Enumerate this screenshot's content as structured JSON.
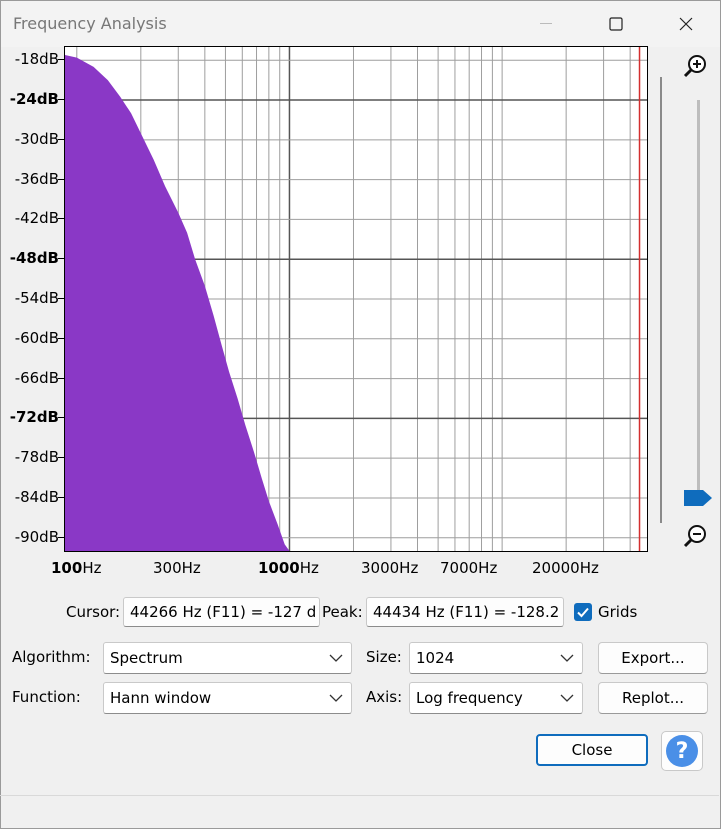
{
  "window": {
    "title": "Frequency Analysis"
  },
  "chart_data": {
    "type": "area",
    "title": "",
    "xlabel": "",
    "ylabel": "",
    "x_scale": "log",
    "xlim": [
      88,
      48000
    ],
    "ylim": [
      -92,
      -16
    ],
    "grid": true,
    "y_ticks": [
      {
        "label": "-18dB",
        "value": -18,
        "bold": false
      },
      {
        "label": "-24dB",
        "value": -24,
        "bold": true
      },
      {
        "label": "-30dB",
        "value": -30,
        "bold": false
      },
      {
        "label": "-36dB",
        "value": -36,
        "bold": false
      },
      {
        "label": "-42dB",
        "value": -42,
        "bold": false
      },
      {
        "label": "-48dB",
        "value": -48,
        "bold": true
      },
      {
        "label": "-54dB",
        "value": -54,
        "bold": false
      },
      {
        "label": "-60dB",
        "value": -60,
        "bold": false
      },
      {
        "label": "-66dB",
        "value": -66,
        "bold": false
      },
      {
        "label": "-72dB",
        "value": -72,
        "bold": true
      },
      {
        "label": "-78dB",
        "value": -78,
        "bold": false
      },
      {
        "label": "-84dB",
        "value": -84,
        "bold": false
      },
      {
        "label": "-90dB",
        "value": -90,
        "bold": false
      }
    ],
    "x_ticks": [
      {
        "label": "100Hz",
        "value": 100,
        "boldpart": "100",
        "rest": "Hz"
      },
      {
        "label": "300Hz",
        "value": 300,
        "boldpart": "",
        "rest": "300Hz"
      },
      {
        "label": "1000Hz",
        "value": 1000,
        "boldpart": "1000",
        "rest": "Hz"
      },
      {
        "label": "3000Hz",
        "value": 3000,
        "boldpart": "",
        "rest": "3000Hz"
      },
      {
        "label": "7000Hz",
        "value": 7000,
        "boldpart": "",
        "rest": "7000Hz"
      },
      {
        "label": "20000Hz",
        "value": 20000,
        "boldpart": "",
        "rest": "20000Hz"
      }
    ],
    "series": [
      {
        "color": "#8a38c6",
        "points": [
          [
            88,
            -17.2
          ],
          [
            100,
            -17.6
          ],
          [
            120,
            -19
          ],
          [
            140,
            -21
          ],
          [
            160,
            -23.5
          ],
          [
            180,
            -26
          ],
          [
            200,
            -29
          ],
          [
            230,
            -33
          ],
          [
            260,
            -37
          ],
          [
            300,
            -41
          ],
          [
            330,
            -44
          ],
          [
            360,
            -48
          ],
          [
            400,
            -52
          ],
          [
            440,
            -56.5
          ],
          [
            480,
            -61
          ],
          [
            520,
            -65
          ],
          [
            570,
            -69
          ],
          [
            620,
            -73
          ],
          [
            680,
            -77
          ],
          [
            740,
            -81
          ],
          [
            800,
            -84.5
          ],
          [
            880,
            -88
          ],
          [
            950,
            -91
          ],
          [
            1000,
            -92
          ]
        ]
      }
    ],
    "cursor_marker_hz": 44266,
    "cursor_color": "#d32f2f"
  },
  "readouts": {
    "cursor_label": "Cursor:",
    "cursor_value": "44266 Hz (F11) = -127 d",
    "peak_label": "Peak:",
    "peak_value": "44434 Hz (F11) = -128.2",
    "grids_label": "Grids",
    "grids_checked": true
  },
  "controls": {
    "algorithm_label": "Algorithm:",
    "algorithm_value": "Spectrum",
    "size_label": "Size:",
    "size_value": "1024",
    "export_label": "Export...",
    "function_label": "Function:",
    "function_value": "Hann window",
    "axis_label": "Axis:",
    "axis_value": "Log frequency",
    "replot_label": "Replot...",
    "close_label": "Close",
    "help_label": "?"
  },
  "icons": [
    "minimize-icon",
    "maximize-icon",
    "close-icon",
    "zoom-in-icon",
    "zoom-out-icon",
    "chevron-down-icon",
    "checkmark-icon",
    "help-icon"
  ]
}
